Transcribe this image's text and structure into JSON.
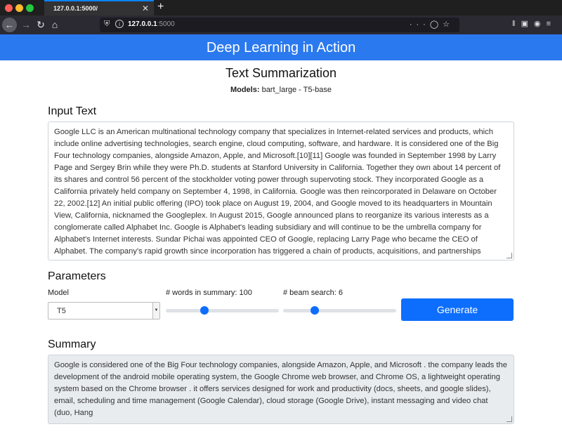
{
  "browser": {
    "tab_title": "127.0.0.1:5000/",
    "tab_close": "✕",
    "new_tab": "+",
    "url_host": "127.0.0.1",
    "url_port": ":5000"
  },
  "header": {
    "app_title": "Deep Learning in Action"
  },
  "page": {
    "title": "Text Summarization",
    "models_label": "Models:",
    "models_value": " bart_large - T5-base"
  },
  "input": {
    "heading": "Input Text",
    "text": "Google LLC is an American multinational technology company that specializes in Internet-related services and products, which include online advertising technologies, search engine, cloud computing, software, and hardware. It is considered one of the Big Four technology companies, alongside Amazon, Apple, and Microsoft.[10][11] Google was founded in September 1998 by Larry Page and Sergey Brin while they were Ph.D. students at Stanford University in California. Together they own about 14 percent of its shares and control 56 percent of the stockholder voting power through supervoting stock. They incorporated Google as a California privately held company on September 4, 1998, in California. Google was then reincorporated in Delaware on October 22, 2002.[12] An initial public offering (IPO) took place on August 19, 2004, and Google moved to its headquarters in Mountain View, California, nicknamed the Googleplex. In August 2015, Google announced plans to reorganize its various interests as a conglomerate called Alphabet Inc. Google is Alphabet's leading subsidiary and will continue to be the umbrella company for Alphabet's Internet interests. Sundar Pichai was appointed CEO of Google, replacing Larry Page who became the CEO of Alphabet. The company's rapid growth since incorporation has triggered a chain of products, acquisitions, and partnerships beyond Google's core search engine (Google Search). It offers services designed for work and productivity (Google Docs, Google Sheets, and Google Slides), email (Gmail), scheduling and"
  },
  "parameters": {
    "heading": "Parameters",
    "model_label": "Model",
    "model_value": "T5",
    "words_label": "# words in summary: 100",
    "words_fraction": 0.34,
    "beam_label": "# beam search: 6",
    "beam_fraction": 0.28,
    "generate_label": "Generate",
    "accent_color": "#0d6efd"
  },
  "summary": {
    "heading": "Summary",
    "text": "Google is considered one of the Big Four technology companies, alongside Amazon, Apple, and Microsoft . the company leads the development of the android mobile operating system, the Google Chrome web browser, and Chrome OS, a lightweight operating system based on the Chrome browser . it offers services designed for work and productivity (docs, sheets, and google slides), email, scheduling and time management (Google Calendar), cloud storage (Google Drive), instant messaging and video chat (duo, Hang"
  },
  "icons": [
    "back-arrow-icon",
    "forward-arrow-icon",
    "reload-icon",
    "home-icon",
    "shield-icon",
    "info-icon",
    "more-icon",
    "pocket-icon",
    "star-icon",
    "library-icon",
    "sidebar-icon",
    "account-icon",
    "menu-icon"
  ]
}
